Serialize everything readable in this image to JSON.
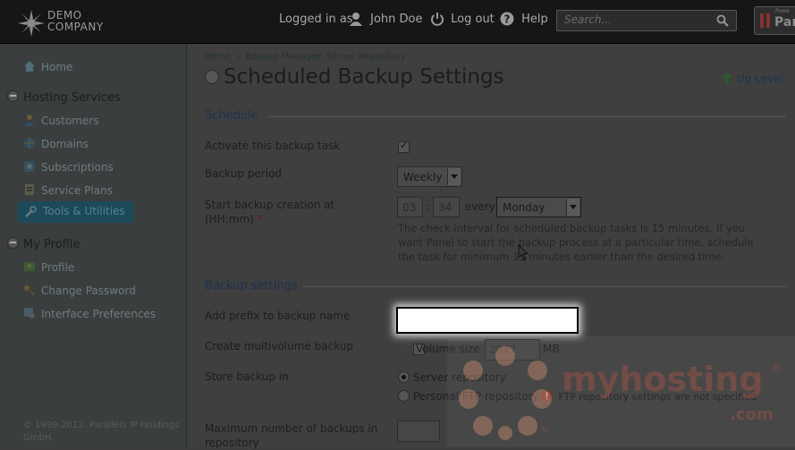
{
  "header": {
    "logo_line1": "DEMO",
    "logo_line2": "COMPANY",
    "logged_in_label": "Logged in as",
    "user_name": "John Doe",
    "logout_label": "Log out",
    "help_label": "Help",
    "search_placeholder": "Search...",
    "brand_small": "Powe",
    "brand_big": "Par"
  },
  "sidebar": {
    "home": "Home",
    "hosting_services": "Hosting Services",
    "customers": "Customers",
    "domains": "Domains",
    "subscriptions": "Subscriptions",
    "service_plans": "Service Plans",
    "tools_utilities": "Tools & Utilities",
    "my_profile": "My Profile",
    "profile": "Profile",
    "change_password": "Change Password",
    "interface_preferences": "Interface Preferences",
    "copyright_line1": "© 1999-2012. Parallels IP Holdings",
    "copyright_line2": "GmbH."
  },
  "breadcrumb": {
    "home": "Home",
    "sep": "›",
    "backup_manager": "Backup Manager: Server Repository"
  },
  "page": {
    "title": "Scheduled Backup Settings",
    "up_level": "Up Level"
  },
  "schedule": {
    "heading": "Schedule",
    "activate_label": "Activate this backup task",
    "activate_checked": "✓",
    "period_label": "Backup period",
    "period_value": "Weekly",
    "start_label_line1": "Start backup creation at",
    "start_label_line2": "(HH:mm)",
    "required_mark": "*",
    "hour": "03",
    "colon": ":",
    "minute": "34",
    "every_label": "every",
    "weekday": "Monday",
    "hint_line1": "The check interval for scheduled backup tasks is 15 minutes. If you",
    "hint_line2": "want Panel to start the backup process at a particular time, schedule",
    "hint_line3": "the task for minimum 15 minutes earlier than the desired time."
  },
  "backup_settings": {
    "heading": "Backup settings",
    "prefix_label": "Add prefix to backup name",
    "prefix_value": "",
    "multivolume_label": "Create multivolume backup",
    "volume_size_label": "Volume size",
    "volume_size_value": "2047",
    "volume_unit": "MB",
    "store_label": "Store backup in",
    "server_repo": "Server repository",
    "ftp_repo": "Personal FTP repository",
    "ftp_warning": "FTP repository settings are not specified",
    "max_backups_label_line1": "Maximum number of backups in",
    "max_backups_label_line2": "repository"
  },
  "watermark": {
    "text": "myhosting",
    "domain": ".com",
    "reg": "®"
  },
  "colors": {
    "selected_nav": "#1b4a5a",
    "link": "#22323a",
    "heading_blue": "#1b3350",
    "warning_red": "#8a2020",
    "watermark": "#9a5046"
  },
  "icons": {
    "logo": "star-burst-icon",
    "user": "user-icon",
    "logout": "power-icon",
    "help": "question-icon",
    "search": "magnifier-icon",
    "up_level": "up-arrow-icon",
    "warning": "exclamation-icon"
  }
}
